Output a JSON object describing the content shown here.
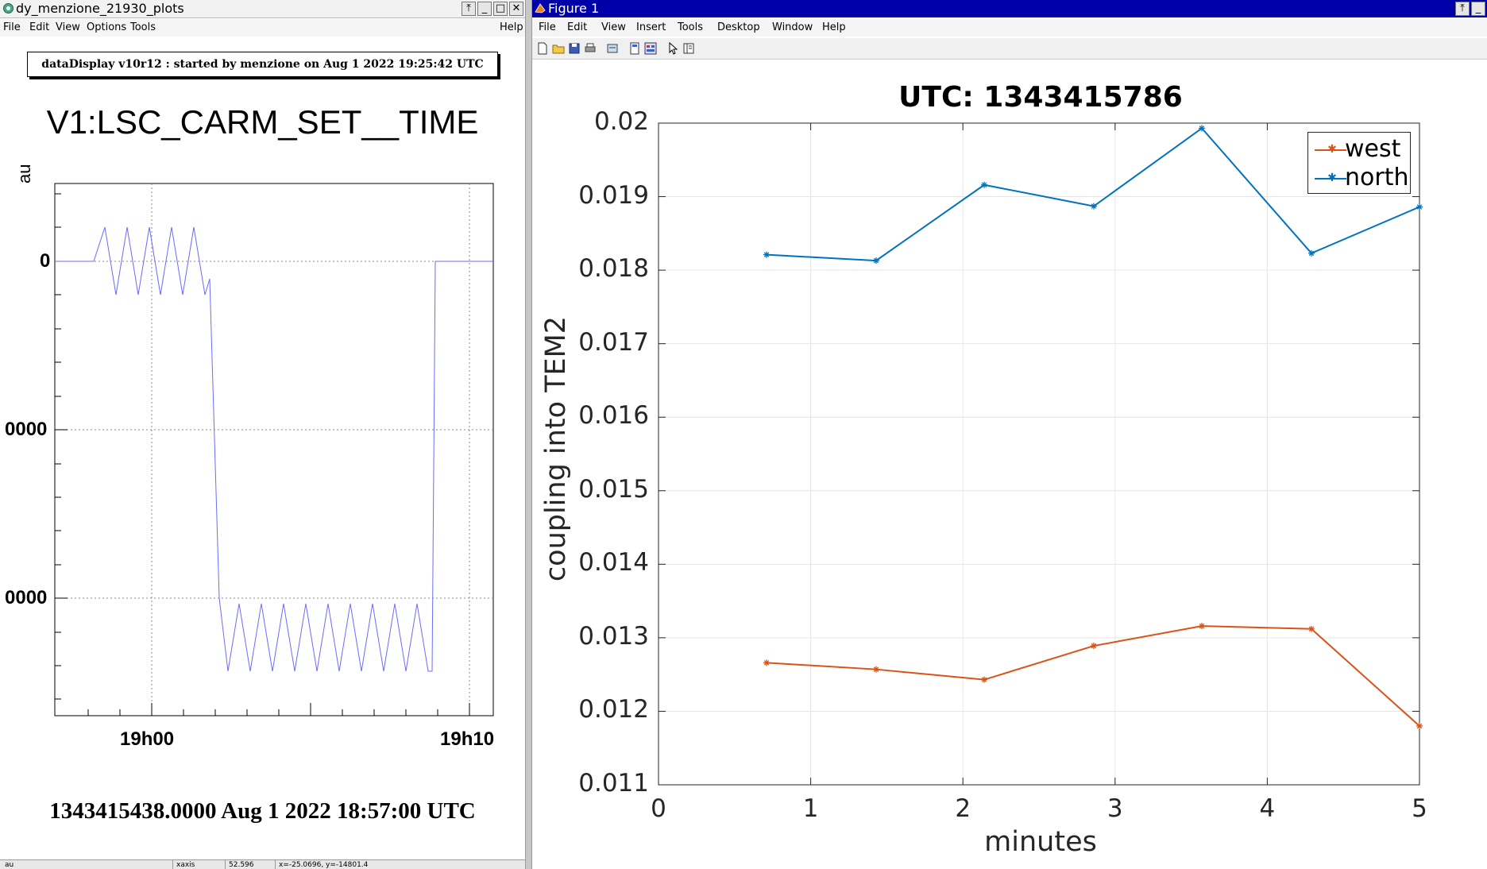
{
  "left_window": {
    "title": "dy_menzione_21930_plots",
    "menu": [
      "File",
      "Edit",
      "View",
      "Options",
      "Tools",
      "Help"
    ],
    "info_banner": "dataDisplay v10r12 : started by menzione on Aug  1 2022 19:25:42 UTC",
    "plot_title": "V1:LSC_CARM_SET__TIME",
    "y_unit": "au",
    "y_ticks": [
      "0",
      "0000",
      "0000"
    ],
    "x_ticks": [
      "19h00",
      "19h10"
    ],
    "timestamp": "1343415438.0000 Aug 1 2022 18:57:00 UTC",
    "status_bar": [
      "au",
      "xaxis",
      "52.596",
      "x=-25.0696, y=-14801.4"
    ],
    "trace_color": "#6b6bff"
  },
  "right_window": {
    "title": "Figure 1",
    "menu": [
      "File",
      "Edit",
      "View",
      "Insert",
      "Tools",
      "Desktop",
      "Window",
      "Help"
    ],
    "toolbar_icons": [
      "new-file-icon",
      "open-folder-icon",
      "save-icon",
      "print-icon",
      "print-preview-icon",
      "plot-tools-icon",
      "dock-icon",
      "pointer-icon",
      "property-editor-icon"
    ]
  },
  "chart_data": {
    "type": "line",
    "title": "UTC: 1343415786",
    "xlabel": "minutes",
    "ylabel": "coupling into TEM2",
    "xlim": [
      0,
      5
    ],
    "ylim": [
      0.011,
      0.02
    ],
    "x_ticks": [
      "0",
      "1",
      "2",
      "3",
      "4",
      "5"
    ],
    "y_ticks": [
      "0.011",
      "0.012",
      "0.013",
      "0.014",
      "0.015",
      "0.016",
      "0.017",
      "0.018",
      "0.019",
      "0.02"
    ],
    "grid": true,
    "legend_position": "top-right",
    "x": [
      0.71,
      1.43,
      2.14,
      2.86,
      3.57,
      4.29,
      5.0
    ],
    "series": [
      {
        "name": "west",
        "color": "#d95319",
        "values": [
          0.01266,
          0.01257,
          0.01243,
          0.01289,
          0.01316,
          0.01312,
          0.0118
        ]
      },
      {
        "name": "north",
        "color": "#0072bd",
        "values": [
          0.01821,
          0.01813,
          0.01916,
          0.01887,
          0.01993,
          0.01823,
          0.01886
        ]
      }
    ]
  }
}
